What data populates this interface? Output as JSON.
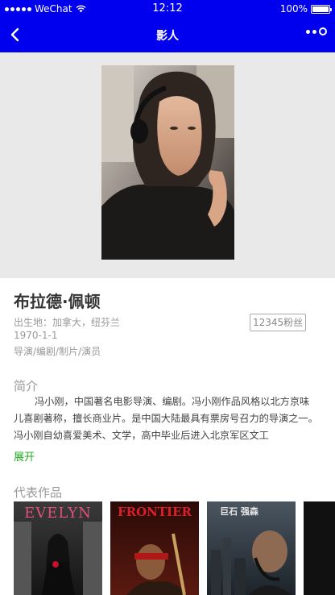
{
  "status_bar": {
    "carrier": "WeChat",
    "time": "12:12",
    "battery": "100%",
    "battery_level": 1.0
  },
  "nav": {
    "title": "影人"
  },
  "person": {
    "name": "布拉德·佩顿",
    "birthplace": "出生地：加拿大，纽芬兰",
    "birthdate": "1970-1-1",
    "roles": "导演/编剧/制片/演员",
    "fans": "12345粉丝"
  },
  "intro": {
    "title": "简介",
    "text": "冯小刚，中国著名电影导演、编剧。冯小刚作品风格以北方京味儿喜剧著称，擅长商业片。是中国大陆最具有票房号召力的导演之一。冯小刚自幼喜爱美术、文学，高中毕业后进入北京军区文工",
    "expand_label": "展开"
  },
  "works": {
    "title": "代表作品",
    "posters": [
      {
        "title": "EVELYN",
        "color": "#e0507a"
      },
      {
        "title": "FRONTIER",
        "color": "#d8202a"
      },
      {
        "title": "巨石 强森",
        "color": "#e8e8e8"
      }
    ]
  }
}
